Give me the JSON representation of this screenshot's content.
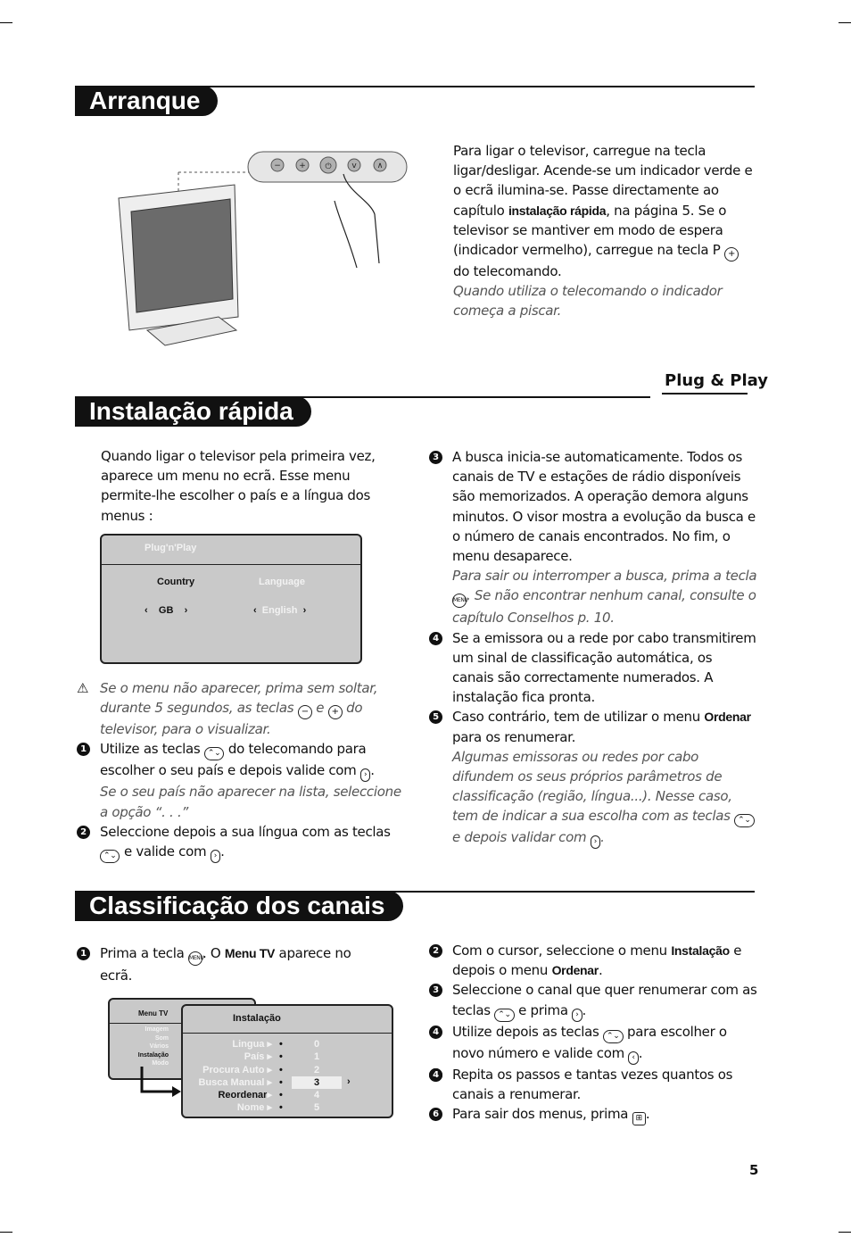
{
  "sections": {
    "arranque": "Arranque",
    "instalacao": "Instalação rápida",
    "classificacao": "Classificação dos canais"
  },
  "logo": {
    "plug_play": "Plug & Play"
  },
  "arranque": {
    "p1": "Para ligar o televisor, carregue na tecla ligar/desligar. Acende-se um indicador verde e o ecrã ilumina-se. Passe directamente ao capítulo ",
    "p1_bold": "instalação rápida",
    "p1_end": ", na página 5. Se o televisor se mantiver em modo de espera (indicador vermelho), carregue na tecla P ",
    "p1_tail": " do telecomando.",
    "note": "Quando utiliza o telecomando o indicador começa a piscar.",
    "tv_buttons": [
      "−",
      "+",
      "⏻",
      "v",
      "∧"
    ]
  },
  "instalacao": {
    "intro": "Quando ligar o televisor pela primeira vez, aparece um menu no ecrã. Esse menu permite-lhe escolher o país e a língua dos menus :",
    "menu": {
      "title": "Plug'n'Play",
      "country_label": "Country",
      "country_value": "GB",
      "language_label": "Language",
      "language_value": "English"
    },
    "warning_a": "Se o menu não aparecer, prima sem soltar, durante 5 segundos, as teclas ",
    "warning_b": " e ",
    "warning_c": " do televisor, para o visualizar.",
    "s1_a": "Utilize as teclas ",
    "s1_b": " do telecomando para escolher o seu país e depois valide com ",
    "s1_c": ".",
    "s1_note": "Se o seu país não aparecer na lista, seleccione a opção “. . .”",
    "s2_a": "Seleccione depois a sua língua com as teclas ",
    "s2_b": " e valide com ",
    "s2_c": ".",
    "s3": "A busca inicia-se automaticamente. Todos os canais de TV e estações de rádio disponíveis são memorizados. A operação demora alguns minutos. O visor mostra a evolução da busca e o número de canais encontrados.  No fim, o menu desaparece.",
    "s3_note_a": "Para sair ou interromper a busca, prima a tecla ",
    "s3_note_b": ". Se não encontrar nenhum canal, consulte o capítulo Conselhos p. 10.",
    "s4": "Se a emissora ou a rede por cabo transmitirem um sinal de classificação automática, os canais  são correctamente numerados. A instalação fica pronta.",
    "s5_a": "Caso contrário, tem de utilizar o menu ",
    "s5_bold": "Ordenar",
    "s5_b": " para os renumerar.",
    "s5_note_a": "Algumas emissoras ou redes por cabo difundem os seus próprios parâmetros de classificação (região, língua...). Nesse caso, tem de indicar a sua escolha com as teclas ",
    "s5_note_b": " e depois validar com ",
    "s5_note_c": "."
  },
  "classificacao": {
    "s1_a": "Prima a tecla ",
    "s1_b": ". O ",
    "s1_bold": "Menu TV",
    "s1_c": " aparece no ecrã.",
    "s2_a": "Com o cursor, seleccione o menu ",
    "s2_bold1": "Instalação",
    "s2_b": " e depois o menu ",
    "s2_bold2": "Ordenar",
    "s2_c": ".",
    "s3_a": "Seleccione o canal que quer renumerar com as teclas ",
    "s3_b": " e prima ",
    "s3_c": ".",
    "s4_a": "Utilize depois as teclas ",
    "s4_b": " para escolher o novo número e valide com ",
    "s4_c": ".",
    "s5_a": "Repita os passos ",
    "s5_b": " e ",
    "s5_c": " tantas vezes quantos os canais a renumerar.",
    "s6_a": "Para sair dos menus, prima ",
    "s6_b": ".",
    "menu_tv": {
      "title": "Menu TV",
      "items": [
        "Imagem",
        "Som",
        "Vários",
        "Instalação",
        "Modo"
      ]
    },
    "menu_inst": {
      "title": "Instalação",
      "items": [
        "Lingua",
        "País",
        "Procura Auto",
        "Busca Manual",
        "Reordenar",
        "Nome"
      ],
      "values": [
        "0",
        "1",
        "2",
        "3",
        "4",
        "5"
      ]
    }
  },
  "keys": {
    "menu": "MENU",
    "minus": "−",
    "plus": "+",
    "n1": "1",
    "n2": "2",
    "n3": "3",
    "n4": "4",
    "n5": "5",
    "n6": "6"
  },
  "page_number": "5"
}
